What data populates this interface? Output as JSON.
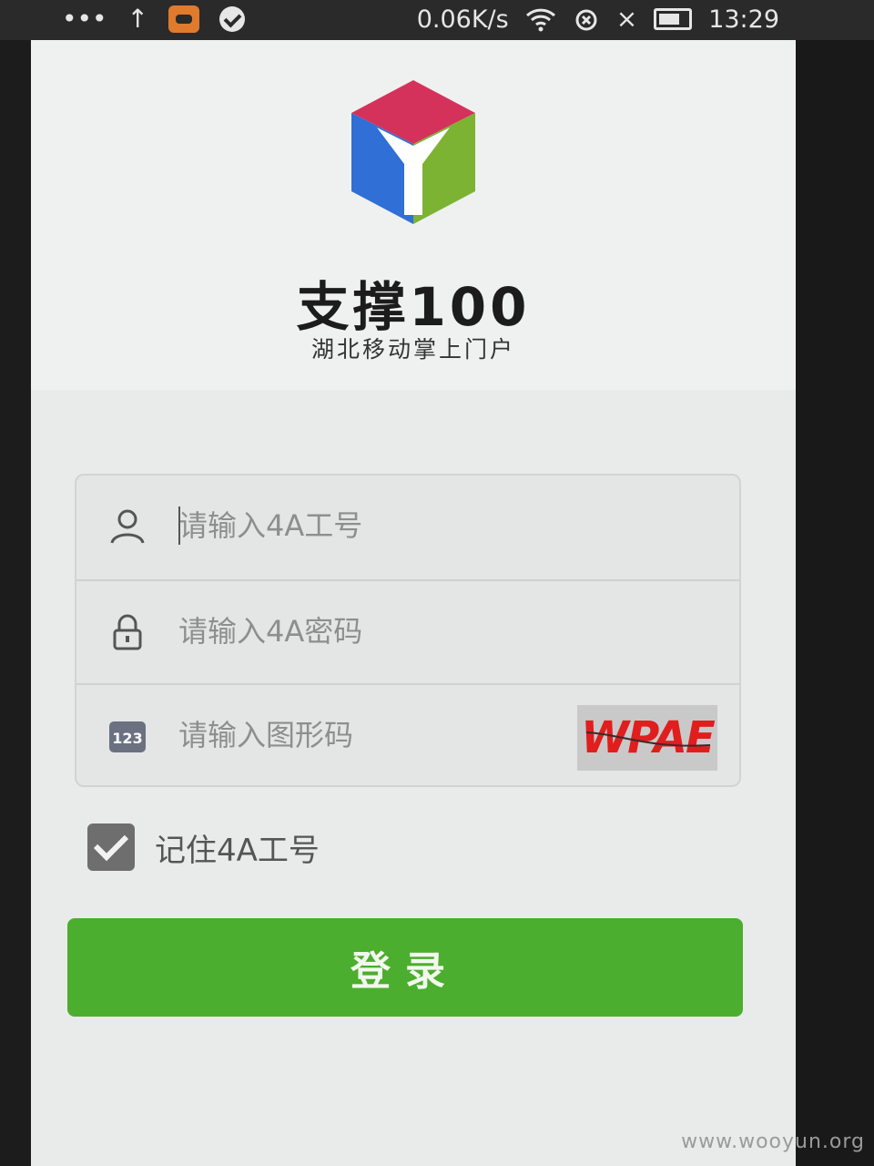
{
  "status_bar": {
    "net_speed": "0.06K/s",
    "time": "13:29",
    "icons": [
      "more-dots-icon",
      "upload-arrow-icon",
      "game-icon",
      "check-circle-icon",
      "wifi-icon",
      "alarm-off-icon",
      "no-signal-icon",
      "battery-icon"
    ]
  },
  "header": {
    "title": "支撑100",
    "subtitle": "湖北移动掌上门户",
    "logo_colors": {
      "top": "#d5325b",
      "left": "#2f6fd6",
      "right": "#7cb332",
      "center": "#ffffff"
    }
  },
  "form": {
    "username_placeholder": "请输入4A工号",
    "password_placeholder": "请输入4A密码",
    "captcha_placeholder": "请输入图形码",
    "captcha_text": "WPAE"
  },
  "remember": {
    "label": "记住4A工号",
    "checked": true
  },
  "login_button": "登录",
  "watermark": "www.wooyun.org",
  "colors": {
    "accent": "#4bae2e",
    "captcha_text": "#e01e1e"
  }
}
